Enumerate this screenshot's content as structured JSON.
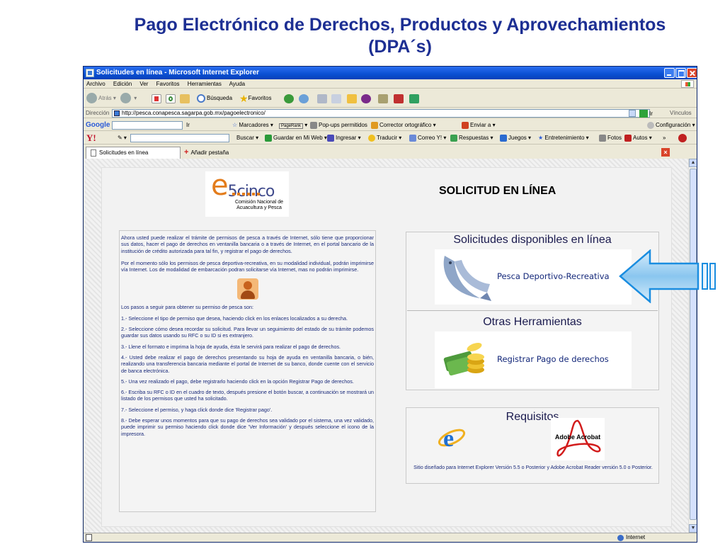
{
  "slide": {
    "title_line1": "Pago Electrónico de Derechos, Productos y Aprovechamientos",
    "title_line2": "(DPA´s)"
  },
  "browser": {
    "window_title": "Solicitudes en línea - Microsoft Internet Explorer",
    "menu": [
      "Archivo",
      "Edición",
      "Ver",
      "Favoritos",
      "Herramientas",
      "Ayuda"
    ],
    "nav": {
      "back_label": "Atrás",
      "search_label": "Búsqueda",
      "favorites_label": "Favoritos"
    },
    "address": {
      "label": "Dirección",
      "url": "http://pesca.conapesca.sagarpa.gob.mx/pagoelectronico/",
      "go_label": "Ir",
      "links_label": "Vínculos"
    },
    "google_toolbar": {
      "logo": "Google",
      "go_label": "Ir",
      "bookmarks_label": "Marcadores",
      "pagerank_label": "PageRank",
      "popups_label": "Pop-ups permitidos",
      "spellcheck_label": "Corrector ortográfico",
      "send_label": "Enviar a",
      "settings_label": "Configuración"
    },
    "yahoo_toolbar": {
      "logo": "Y!",
      "search_label": "Buscar",
      "save_label": "Guardar en Mi Web",
      "login_label": "Ingresar",
      "translate_label": "Traducir",
      "mail_label": "Correo Y!",
      "answers_label": "Respuestas",
      "games_label": "Juegos",
      "entertainment_label": "Entretenimiento",
      "photos_label": "Fotos",
      "autos_label": "Autos"
    },
    "tabs": {
      "active_label": "Solicitudes en línea",
      "new_tab_label": "Añadir pestaña"
    },
    "status": {
      "zone_label": "Internet"
    }
  },
  "page": {
    "logo": {
      "mark_e": "e",
      "mark_rest": "5cinco",
      "subtitle": "Comisión Nacional de Acuacultura y Pesca"
    },
    "heading": "SOLICITUD EN LÍNEA",
    "instructions": {
      "intro1": "Ahora usted puede realizar el trámite de permisos de pesca a través de Internet, sólo tiene que proporcionar sus datos, hacer el pago de derechos en ventanilla bancaria o a través de Internet, en el portal bancario de la institución de crédito autorizada para tal fin, y registrar el pago de derechos.",
      "intro2": "Por el momento sólo los permisos de pesca deportiva-recreativa, en su modalidad individual, podrán imprimirse vía Internet. Los de modalidad de embarcación podran solicitarse vía Internet, mas no podrán imprimirse.",
      "steps_title": "Los pasos a seguir para obtener su permiso de pesca son:",
      "steps": [
        "1.- Seleccione el tipo de permiso que desea, haciendo click en los enlaces localizados a su derecha.",
        "2.- Seleccione cómo desea recordar su solicitud. Para llevar un seguimiento del estado de su trámite podemos guardar sus datos usando su RFC o su ID si es extranjero.",
        "3.- Llene el formato e imprima la hoja de ayuda, ésta le servirá para realizar el pago de derechos.",
        "4.- Usted debe realizar el pago de derechos presentando su hoja de ayuda en ventanilla bancaria, o bién, realizando una transferencia bancaria mediante el portal de Internet de su banco, donde cuente con el servicio de banca electrónica.",
        "5.- Una vez realizado el pago, debe registrarlo haciendo click en la opción Registrar Pago de derechos.",
        "6.- Escriba su RFC o ID en el cuadro de texto, después presione el botón buscar, a continuación se mostrará un listado de los permisos que usted ha solicitado.",
        "7.- Seleccione el permiso, y haga click donde dice 'Registrar pago'.",
        "8.- Debe esperar unos momentos para que su pago de derechos sea validado por el sistema, una vez validado, puede imprimir su permiso haciendo click donde dice 'Ver Información' y después seleccione el icono de la impresora."
      ]
    },
    "solicitudes": {
      "heading": "Solicitudes disponibles en línea",
      "pesca_label": "Pesca Deportivo-Recreativa",
      "otras_heading": "Otras Herramientas",
      "registrar_label": "Registrar Pago de derechos"
    },
    "requisitos": {
      "heading": "Requisitos",
      "adobe_label": "Adobe Acrobat",
      "note": "Sitio diseñado para Internet Explorer Versión 5.5 o Posterior y Adobe Acrobat Reader versión 5.0 o Posterior."
    }
  },
  "colors": {
    "title_blue": "#1d2f93",
    "link_blue": "#14287a",
    "arrow_blue": "#1a8de0"
  }
}
